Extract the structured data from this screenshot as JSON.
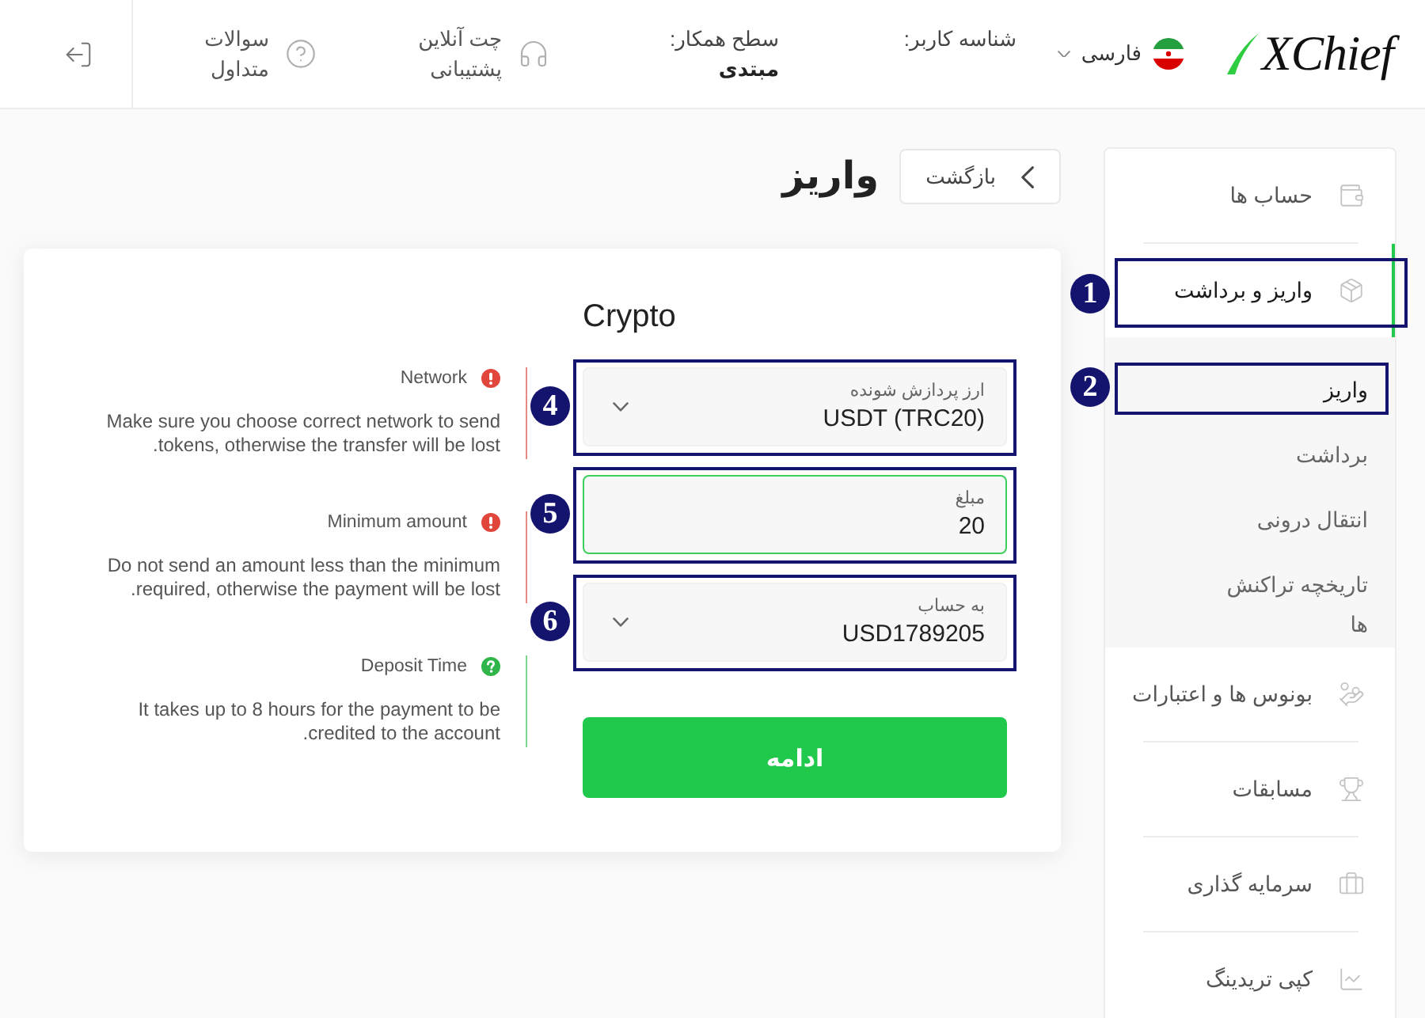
{
  "header": {
    "logo": "XChief",
    "language": "فارسی",
    "user_id_label": "شناسه کاربر:",
    "level_label": "سطح همکار:",
    "level_value": "مبتدی",
    "links": [
      {
        "lines": [
          "چت آنلاین",
          "پشتیبانی"
        ]
      },
      {
        "lines": [
          "سوالات",
          "متداول"
        ]
      }
    ]
  },
  "page": {
    "title": "واریز",
    "back_button": "بازگشت"
  },
  "card": {
    "title": "Crypto",
    "fields": [
      {
        "kind": "select",
        "label": "ارز پردازش شونده",
        "value": "USDT (TRC20)",
        "focused": false,
        "callout": "4"
      },
      {
        "kind": "input",
        "label": "مبلغ",
        "value": "20",
        "focused": true,
        "callout": "5"
      },
      {
        "kind": "select",
        "label": "به حساب",
        "value": "USD1789205",
        "focused": false,
        "callout": "6"
      }
    ],
    "submit_button": "ادامه",
    "notes": [
      {
        "kind": "warning",
        "title": "Network",
        "text": "Make sure you choose correct network to send tokens, otherwise the transfer will be lost."
      },
      {
        "kind": "warning",
        "title": "Minimum amount",
        "text": "Do not send an amount less than the minimum required, otherwise the payment will be lost."
      },
      {
        "kind": "info",
        "title": "Deposit Time",
        "text": "It takes up to 8 hours for the payment to be credited to the account."
      }
    ]
  },
  "sidebar": {
    "items": [
      {
        "label": "حساب ها",
        "selected": false
      },
      {
        "label": "واریز و برداشت",
        "selected": true,
        "callout": "1",
        "children": [
          {
            "label": "واریز",
            "selected": true,
            "callout": "2"
          },
          {
            "label": "برداشت",
            "selected": false
          },
          {
            "label": "انتقال درونی",
            "selected": false
          },
          {
            "label": "تاریخچه تراکنش ها",
            "selected": false
          }
        ]
      },
      {
        "label": "بونوس ها و اعتبارات",
        "selected": false
      },
      {
        "label": "مسابقات",
        "selected": false
      },
      {
        "label": "سرمایه گذاری",
        "selected": false
      },
      {
        "label": "کپی تریدینگ",
        "selected": false
      }
    ]
  }
}
